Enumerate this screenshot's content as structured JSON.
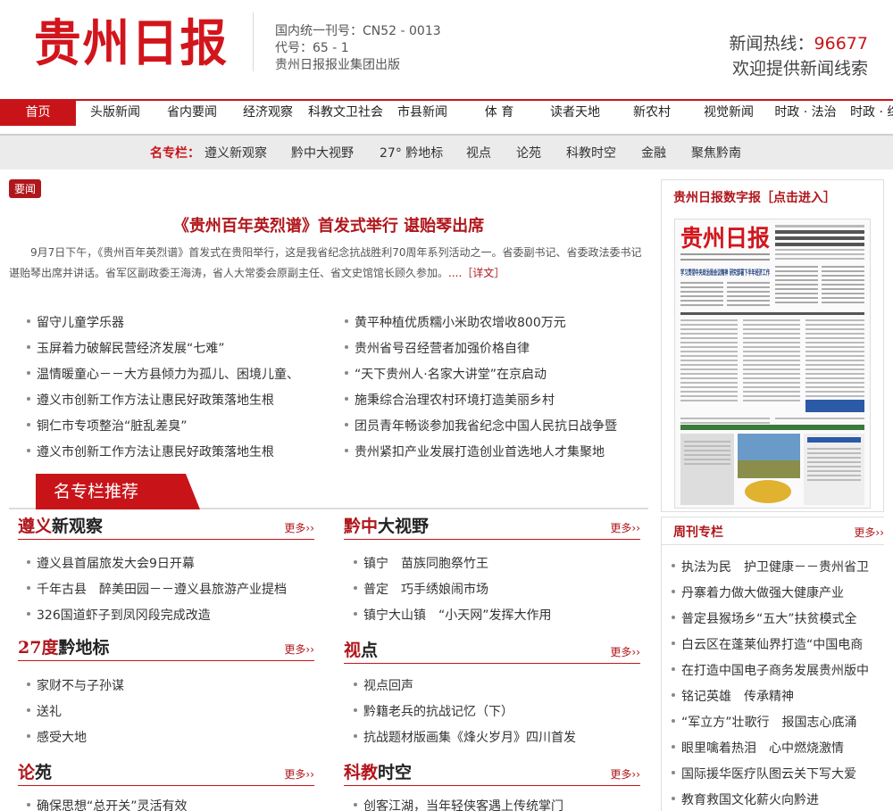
{
  "header": {
    "logo_text": "贵州日报",
    "pub_line1": "国内统一刊号：CN52 - 0013",
    "pub_line2": "代号：65 - 1",
    "pub_line3": "贵州日报报业集团出版",
    "hotline_label": "新闻热线：",
    "hotline_number": "96677",
    "hotline_sub": "欢迎提供新闻线索"
  },
  "nav": {
    "items": [
      "首页",
      "头版新闻",
      "省内要闻",
      "经济观察",
      "科教文卫社会",
      "市县新闻",
      "体 育",
      "读者天地",
      "新农村",
      "视觉新闻",
      "时政 · 法治",
      "时政 · 综"
    ]
  },
  "subnav": {
    "label": "名专栏：",
    "items": [
      "遵义新观察",
      "黔中大视野",
      "27° 黔地标",
      "视点",
      "论苑",
      "科教时空",
      "金融",
      "聚焦黔南"
    ]
  },
  "lead": {
    "badge": "要闻",
    "headline": "《贵州百年英烈谱》首发式举行 谌贻琴出席",
    "summary": "9月7日下午，《贵州百年英烈谱》首发式在贵阳举行，这是我省纪念抗战胜利70周年系列活动之一。省委副书记、省委政法委书记谌贻琴出席并讲话。省军区副政委王海涛，省人大常委会原副主任、省文史馆馆长顾久参加。",
    "more": "....［详文］"
  },
  "news_left": [
    "留守儿童学乐器",
    "玉屏着力破解民营经济发展“七难”",
    "温情暖童心－－大方县倾力为孤儿、困境儿童、",
    "遵义市创新工作方法让惠民好政策落地生根",
    "铜仁市专项整治“脏乱差臭”",
    "遵义市创新工作方法让惠民好政策落地生根"
  ],
  "news_right": [
    "黄平种植优质糯小米助农增收800万元",
    "贵州省号召经营者加强价格自律",
    "“天下贵州人·名家大讲堂”在京启动",
    "施秉综合治理农村环境打造美丽乡村",
    "团员青年畅谈参加我省纪念中国人民抗日战争暨",
    "贵州紧扣产业发展打造创业首选地人才集聚地"
  ],
  "recommend_title": "名专栏推荐",
  "more_label": "更多",
  "sections": [
    {
      "title_red": "遵义",
      "title_rest": "新观察",
      "items": [
        "遵义县首届旅发大会9日开幕",
        "千年古县　醉美田园－－遵义县旅游产业提档",
        "326国道虾子到凤冈段完成改造"
      ]
    },
    {
      "title_red": "黔中",
      "title_rest": "大视野",
      "items": [
        "镇宁　苗族同胞祭竹王",
        "普定　巧手绣娘闹市场",
        "镇宁大山镇　“小天网”发挥大作用"
      ]
    },
    {
      "title_red": "27度",
      "title_rest": "黔地标",
      "items": [
        "家财不与子孙谋",
        "送礼",
        "感受大地"
      ]
    },
    {
      "title_red": "视",
      "title_rest": "点",
      "items": [
        "视点回声",
        "黔籍老兵的抗战记忆（下）",
        "抗战题材版画集《烽火岁月》四川首发"
      ]
    },
    {
      "title_red": "论",
      "title_rest": "苑",
      "items": [
        "确保思想“总开关”灵活有效"
      ]
    },
    {
      "title_red": "科教",
      "title_rest": "时空",
      "items": [
        "创客江湖，当年轻侠客遇上传统掌门"
      ]
    }
  ],
  "epaper": {
    "title": "贵州日报数字报［点击进入］",
    "masthead": "贵州日报",
    "banner": "学习贯彻中央政治局会议精神 研究部署下半年经济工作"
  },
  "weekly": {
    "title": "周刊专栏",
    "items": [
      "执法为民　护卫健康－－贵州省卫",
      "丹寨着力做大做强大健康产业",
      "普定县猴场乡“五大”扶贫模式全",
      "白云区在蓬莱仙界打造“中国电商",
      "在打造中国电子商务发展贵州版中",
      "铭记英雄　传承精神",
      "“军立方”壮歌行　报国志心底涌",
      "眼里噙着热泪　心中燃烧激情",
      "国际援华医疗队图云关下写大爱",
      "教育救国文化薪火向黔进"
    ]
  },
  "colors": {
    "brand_red": "#c81419",
    "dark_red": "#b0161b"
  }
}
